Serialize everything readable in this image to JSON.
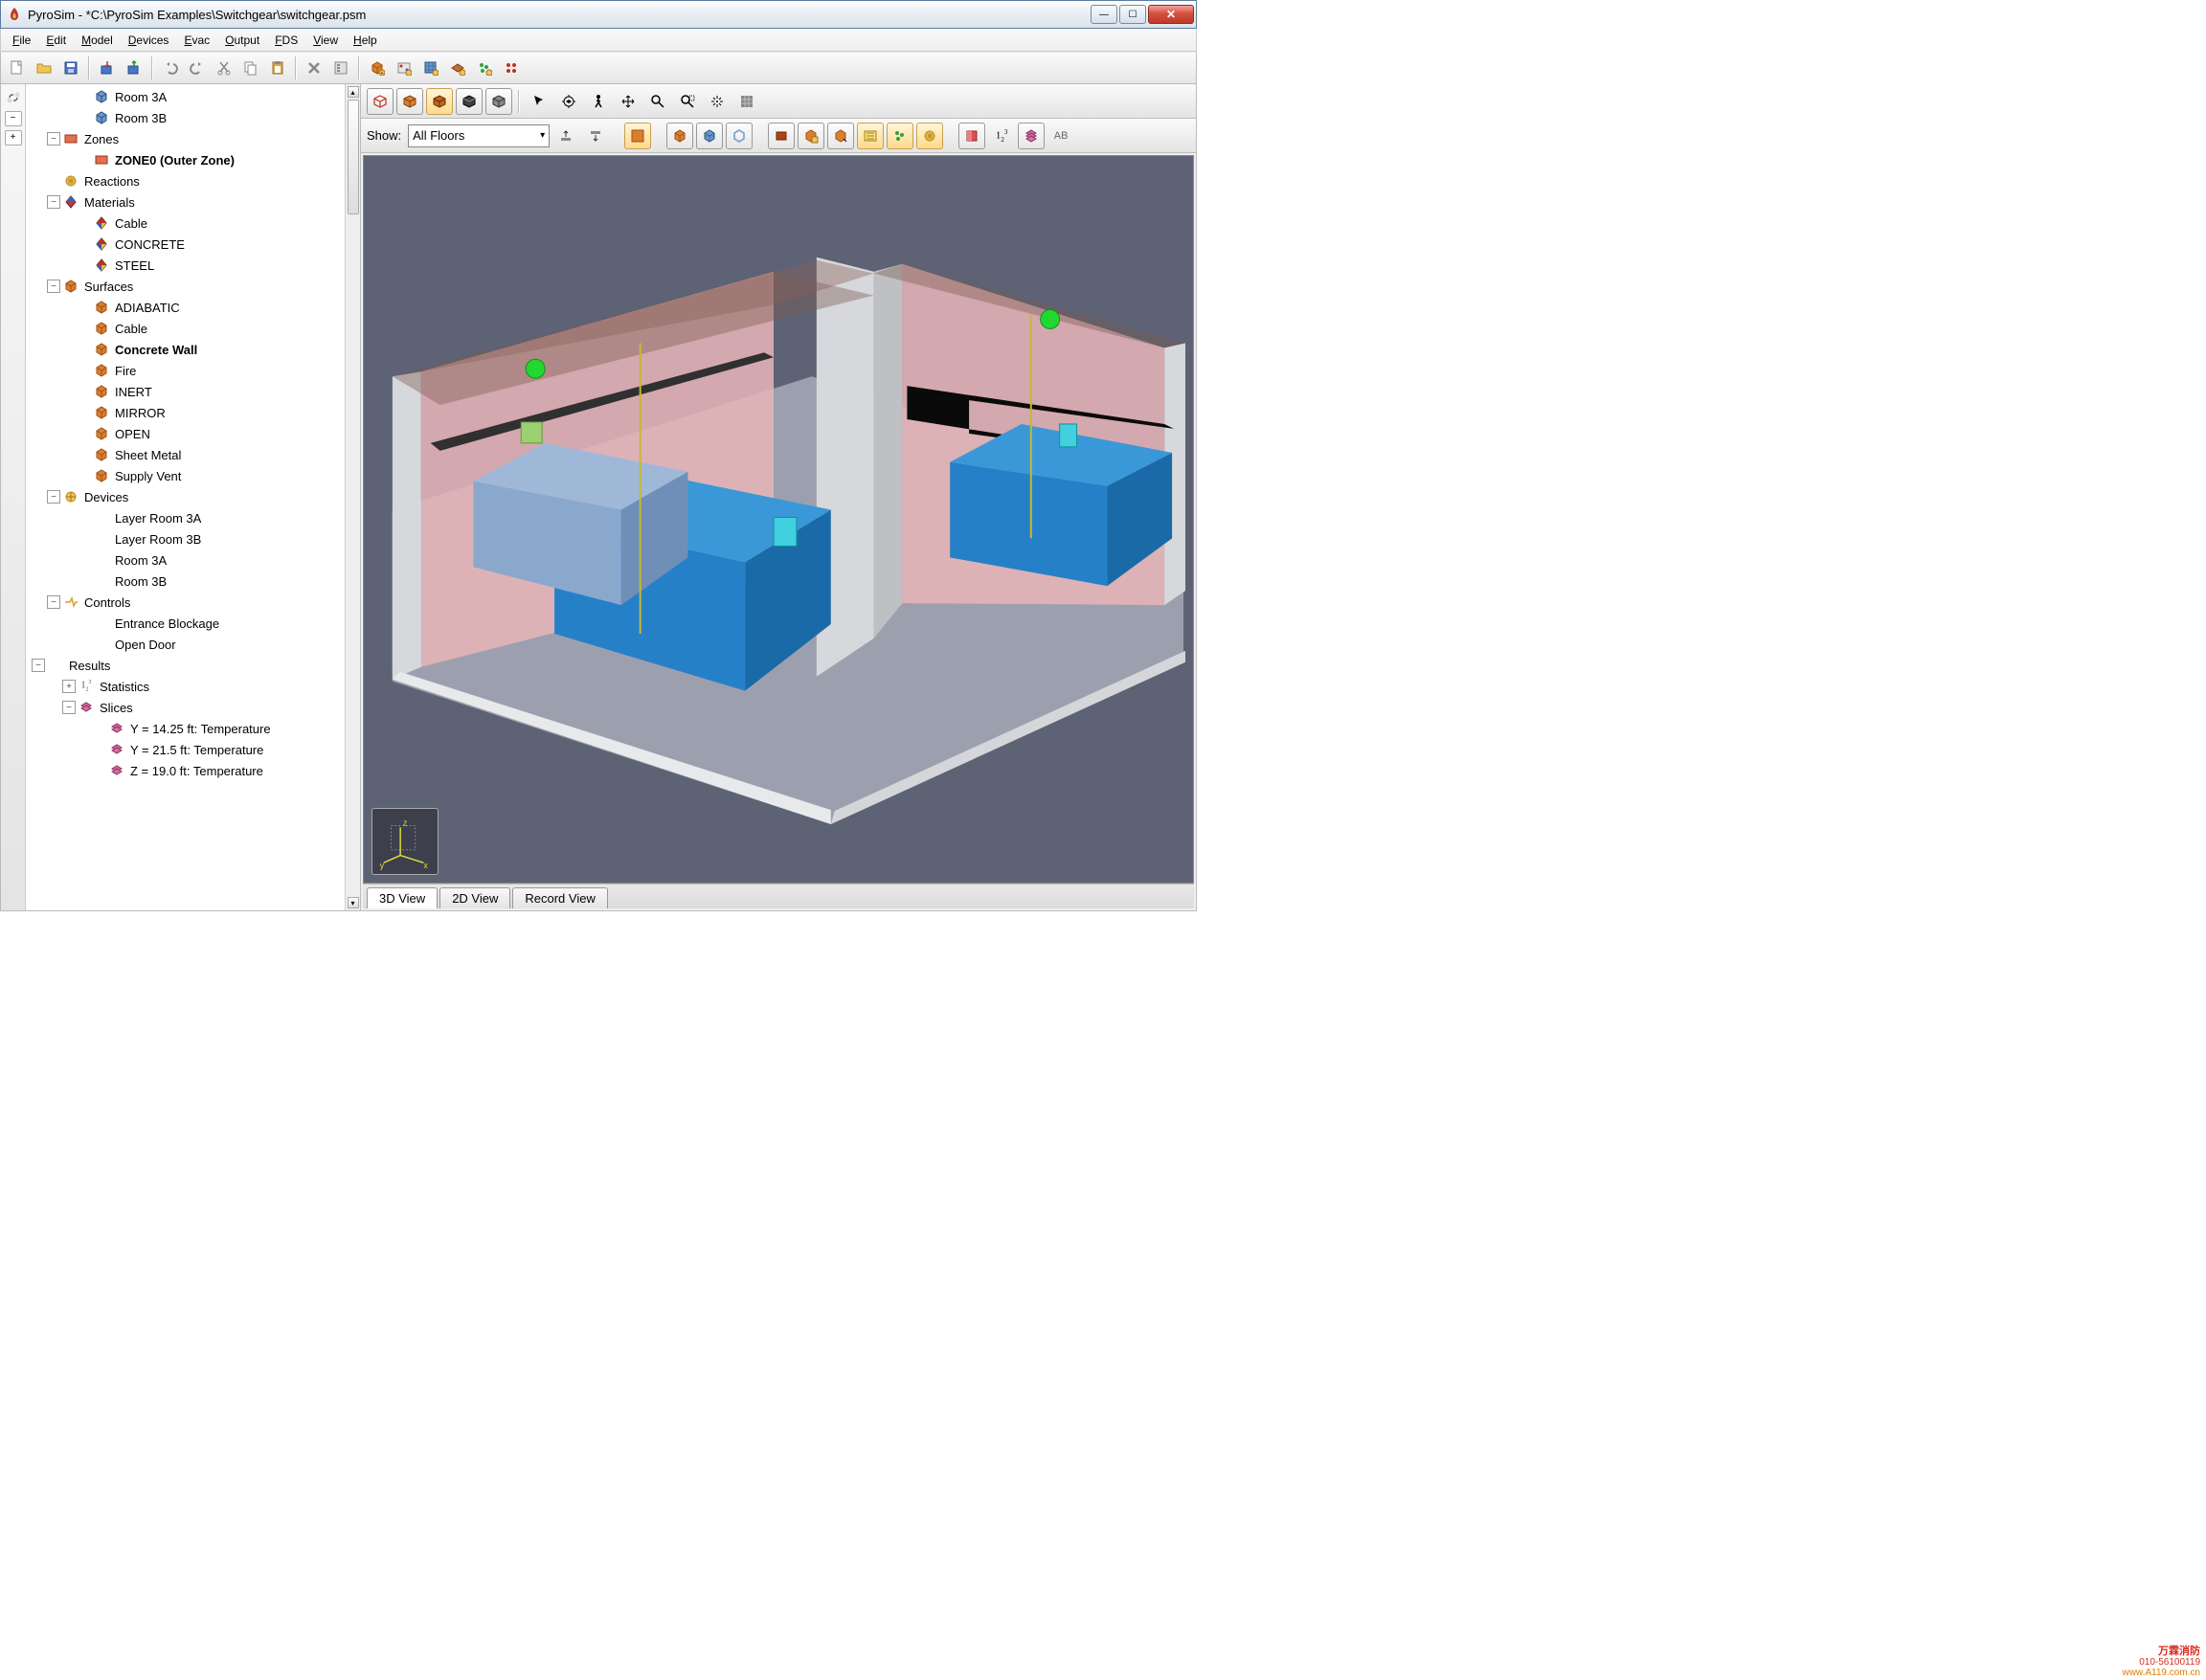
{
  "window": {
    "title": "PyroSim - *C:\\PyroSim Examples\\Switchgear\\switchgear.psm"
  },
  "menu": [
    "File",
    "Edit",
    "Model",
    "Devices",
    "Evac",
    "Output",
    "FDS",
    "View",
    "Help"
  ],
  "toolbar": {
    "buttons": [
      "new",
      "open",
      "save",
      "import",
      "export",
      "undo",
      "redo",
      "cut",
      "copy",
      "paste",
      "delete",
      "properties",
      "mesh",
      "reaction",
      "surface",
      "material",
      "particle",
      "device"
    ]
  },
  "tree": [
    {
      "indent": 3,
      "icon": "cube-blue",
      "label": "Room 3A"
    },
    {
      "indent": 3,
      "icon": "cube-blue",
      "label": "Room 3B"
    },
    {
      "indent": 1,
      "toggle": "-",
      "icon": "zone",
      "label": "Zones"
    },
    {
      "indent": 3,
      "icon": "zone",
      "label": "ZONE0 (Outer Zone)",
      "bold": true
    },
    {
      "indent": 1,
      "icon": "reaction",
      "label": "Reactions"
    },
    {
      "indent": 1,
      "toggle": "-",
      "icon": "material",
      "label": "Materials"
    },
    {
      "indent": 3,
      "icon": "diamond",
      "label": "Cable"
    },
    {
      "indent": 3,
      "icon": "diamond",
      "label": "CONCRETE"
    },
    {
      "indent": 3,
      "icon": "diamond",
      "label": "STEEL"
    },
    {
      "indent": 1,
      "toggle": "-",
      "icon": "surface",
      "label": "Surfaces"
    },
    {
      "indent": 3,
      "icon": "surface",
      "label": "ADIABATIC"
    },
    {
      "indent": 3,
      "icon": "surface",
      "label": "Cable"
    },
    {
      "indent": 3,
      "icon": "surface",
      "label": "Concrete Wall",
      "bold": true
    },
    {
      "indent": 3,
      "icon": "surface",
      "label": "Fire"
    },
    {
      "indent": 3,
      "icon": "surface",
      "label": "INERT"
    },
    {
      "indent": 3,
      "icon": "surface",
      "label": "MIRROR"
    },
    {
      "indent": 3,
      "icon": "surface",
      "label": "OPEN"
    },
    {
      "indent": 3,
      "icon": "surface",
      "label": "Sheet Metal"
    },
    {
      "indent": 3,
      "icon": "surface",
      "label": "Supply Vent"
    },
    {
      "indent": 1,
      "toggle": "-",
      "icon": "device",
      "label": "Devices"
    },
    {
      "indent": 3,
      "icon": "",
      "label": "Layer Room 3A"
    },
    {
      "indent": 3,
      "icon": "",
      "label": "Layer Room 3B"
    },
    {
      "indent": 3,
      "icon": "",
      "label": "Room 3A"
    },
    {
      "indent": 3,
      "icon": "",
      "label": "Room 3B"
    },
    {
      "indent": 1,
      "toggle": "-",
      "icon": "control",
      "label": "Controls"
    },
    {
      "indent": 3,
      "icon": "",
      "label": "Entrance Blockage"
    },
    {
      "indent": 3,
      "icon": "",
      "label": "Open Door"
    },
    {
      "indent": 0,
      "toggle": "-",
      "icon": "",
      "label": "Results"
    },
    {
      "indent": 2,
      "toggle": "+",
      "icon": "stats",
      "label": "Statistics"
    },
    {
      "indent": 2,
      "toggle": "-",
      "icon": "slice",
      "label": "Slices"
    },
    {
      "indent": 4,
      "icon": "slice",
      "label": "Y = 14.25 ft: Temperature"
    },
    {
      "indent": 4,
      "icon": "slice",
      "label": "Y = 21.5 ft: Temperature"
    },
    {
      "indent": 4,
      "icon": "slice",
      "label": "Z = 19.0 ft: Temperature"
    }
  ],
  "viewport": {
    "show_label": "Show:",
    "floor_selected": "All Floors",
    "tool_groups1": [
      "wireframe",
      "solid",
      "realistic",
      "shadow",
      "outline",
      "select",
      "orbit",
      "walk",
      "pan",
      "zoom",
      "zoom-box",
      "reset",
      "grid"
    ],
    "tool_groups2": [
      "filter1",
      "filter2",
      "obj",
      "mesh",
      "dev",
      "surf",
      "sep",
      "slice1",
      "slice2",
      "slice3",
      "layers",
      "particles",
      "hrr",
      "sep",
      "plane",
      "stats",
      "plot3d",
      "label"
    ]
  },
  "tabs": [
    "3D View",
    "2D View",
    "Record View"
  ],
  "watermark": {
    "line1": "万霖消防",
    "line2": "010-56100119",
    "line3": "www.A119.com.cn"
  }
}
